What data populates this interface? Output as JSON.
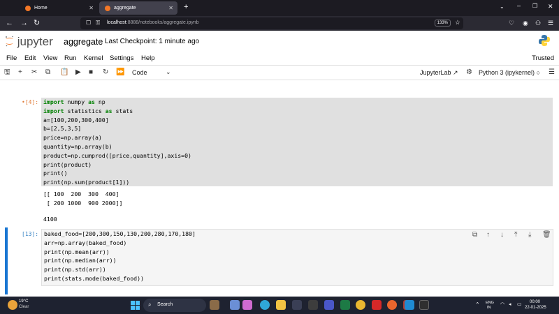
{
  "browser": {
    "tabs": [
      {
        "label": "Home",
        "active": false
      },
      {
        "label": "aggregate",
        "active": true
      }
    ],
    "new_tab": "+",
    "url_host": "localhost",
    "url_path": ":8888/notebooks/aggregate.ipynb",
    "zoom": "133%"
  },
  "jupyter": {
    "logo_text": "jupyter",
    "notebook_title": "aggregate",
    "checkpoint": "Last Checkpoint: 1 minute ago",
    "menu": [
      "File",
      "Edit",
      "View",
      "Run",
      "Kernel",
      "Settings",
      "Help"
    ],
    "trusted": "Trusted",
    "cell_type": "Code",
    "jupyterlab_link": "JupyterLab",
    "kernel_name": "Python 3 (ipykernel)"
  },
  "cells": [
    {
      "prompt": "[4]:",
      "prompt_marker": "•",
      "code_lines": [
        "import numpy as np",
        "import statistics as stats",
        "a=[100,200,300,400]",
        "b=[2,5,3,5]",
        "price=np.array(a)",
        "quantity=np.array(b)",
        "product=np.cumprod([price,quantity],axis=0)",
        "print(product)",
        "print()",
        "print(np.sum(product[1]))"
      ],
      "output_lines": [
        "[[ 100  200  300  400]",
        " [ 200 1000  900 2000]]"
      ],
      "output_extra": "4100"
    },
    {
      "prompt": "[13]:",
      "code_lines": [
        "baked_food=[200,300,150,130,200,280,170,180]",
        "arr=np.array(baked_food)",
        "print(np.mean(arr))",
        "print(np.median(arr))",
        "print(np.std(arr))",
        "print(stats.mode(baked_food))"
      ]
    }
  ],
  "taskbar": {
    "temperature": "19°C",
    "weather": "Clear",
    "search_label": "Search",
    "lang_line1": "ENG",
    "lang_line2": "IN",
    "time": "00:00",
    "date": "22-01-2025"
  },
  "colors": {
    "jupyter_orange": "#f37726",
    "active_cell_bar": "#1976d2",
    "browser_dark": "#1c1b22",
    "taskbar": "#1e2230"
  }
}
